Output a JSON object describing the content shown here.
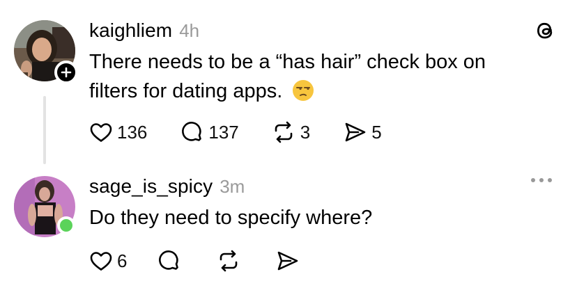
{
  "posts": [
    {
      "username": "kaighliem",
      "time": "4h",
      "text_line1": "There needs to be a “has hair” check box on",
      "text_line2": "filters for dating apps.",
      "emoji_name": "unamused-face",
      "likes": "136",
      "replies": "137",
      "reposts": "3",
      "shares": "5"
    },
    {
      "username": "sage_is_spicy",
      "time": "3m",
      "text": "Do they need to specify where?",
      "likes": "6"
    }
  ],
  "icons": {
    "brand": "threads-logo-icon",
    "follow": "plus-icon",
    "more": "more-options-icon"
  },
  "colors": {
    "online": "#5bd35a",
    "muted": "#9a9a9a",
    "emoji": "#f7c53e"
  }
}
